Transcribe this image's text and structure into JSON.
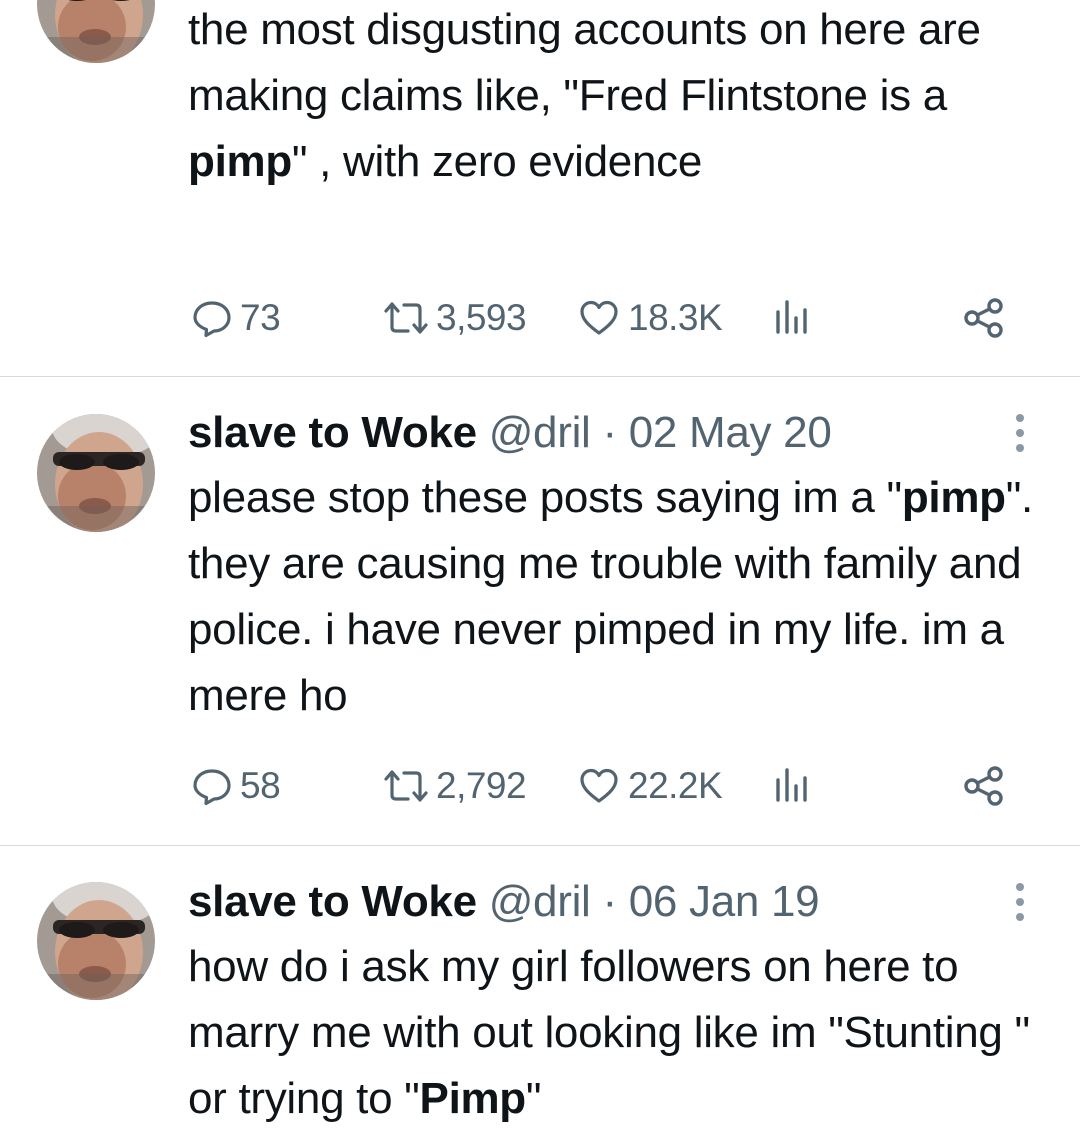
{
  "tweets": [
    {
      "partial": true,
      "text_parts": {
        "p1": "the most disgusting accounts on here are making claims like, \"Fred Flintstone is a ",
        "b1": "pimp",
        "p2": "\" , with zero evidence"
      },
      "stats": {
        "replies": "73",
        "retweets": "3,593",
        "likes": "18.3K"
      }
    },
    {
      "display_name": "slave to Woke",
      "handle": "@dril",
      "separator": "·",
      "date": "02 May 20",
      "text_parts": {
        "p1": "please stop these posts saying im a \"",
        "b1": "pimp",
        "p2": "\". they are causing me trouble with family and police. i have never pimped in my life. im a mere ho"
      },
      "stats": {
        "replies": "58",
        "retweets": "2,792",
        "likes": "22.2K"
      }
    },
    {
      "display_name": "slave to Woke",
      "handle": "@dril",
      "separator": "·",
      "date": "06 Jan 19",
      "text_parts": {
        "p1": "how do i ask my girl followers on here to marry me with out looking like im \"Stunting \" or trying to \"",
        "b1": "Pimp",
        "p2": "\""
      }
    }
  ],
  "icons": {
    "reply": "speech-bubble-icon",
    "retweet": "retweet-icon",
    "like": "heart-icon",
    "views": "bar-chart-icon",
    "share": "share-icon",
    "more": "vertical-ellipsis-icon",
    "avatar": "man-with-sunglasses-avatar"
  },
  "colors": {
    "text": "#0f1419",
    "secondary": "#536471",
    "divider": "#d4dbe0"
  }
}
